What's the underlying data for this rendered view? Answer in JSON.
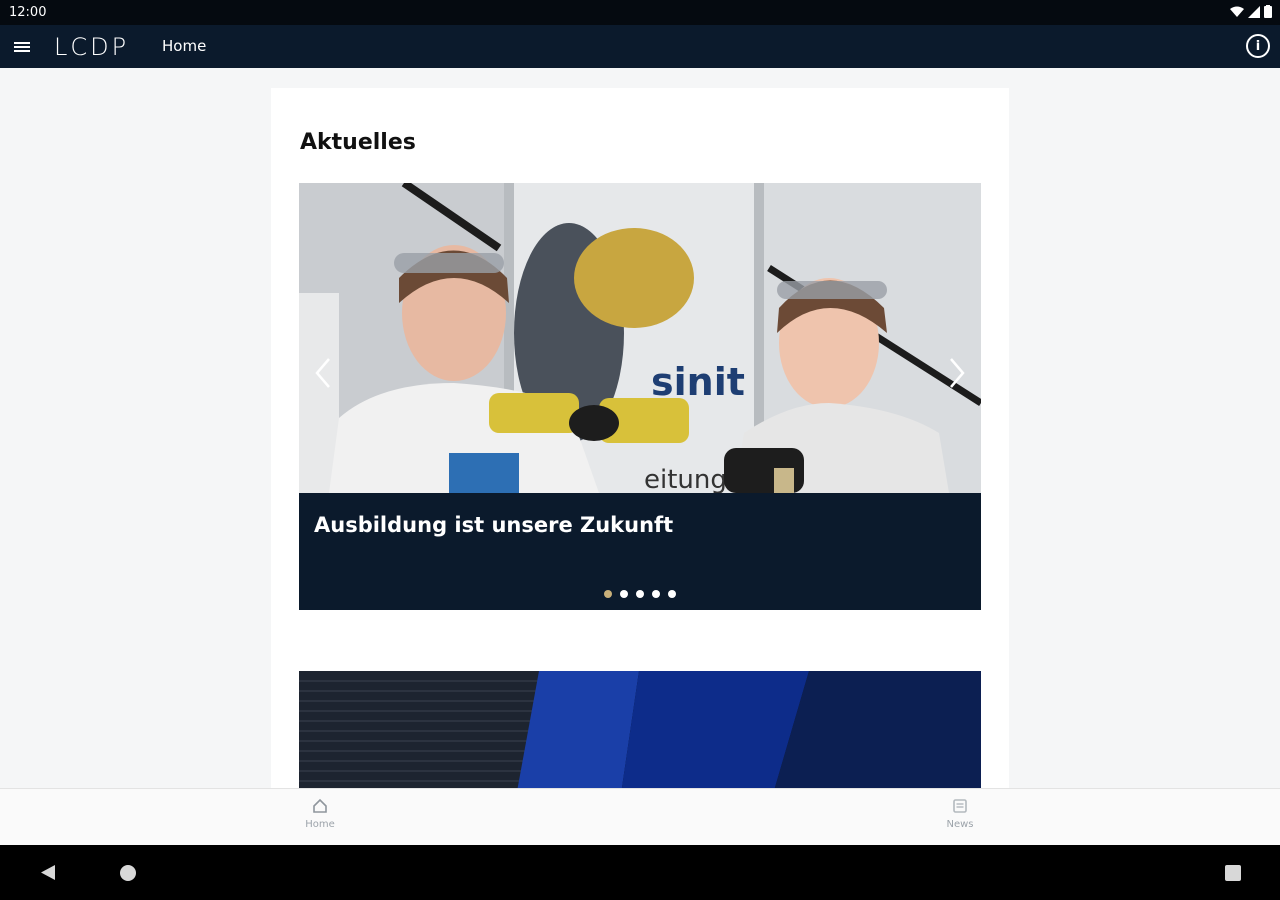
{
  "status_bar": {
    "time": "12:00"
  },
  "app_bar": {
    "logo": "LCDP",
    "title": "Home"
  },
  "section": {
    "title": "Aktuelles"
  },
  "slider": {
    "caption": "Ausbildung ist unsere Zukunft",
    "image_sign_text": "sinit",
    "image_partial_text": "eitung",
    "slide_count": 5,
    "active_index": 0
  },
  "bottom_nav": {
    "home_label": "Home",
    "news_label": "News"
  },
  "colors": {
    "app_bar_bg": "#0b1a2c",
    "caption_bg": "#0b1a2c",
    "active_dot": "#c9b07a"
  }
}
